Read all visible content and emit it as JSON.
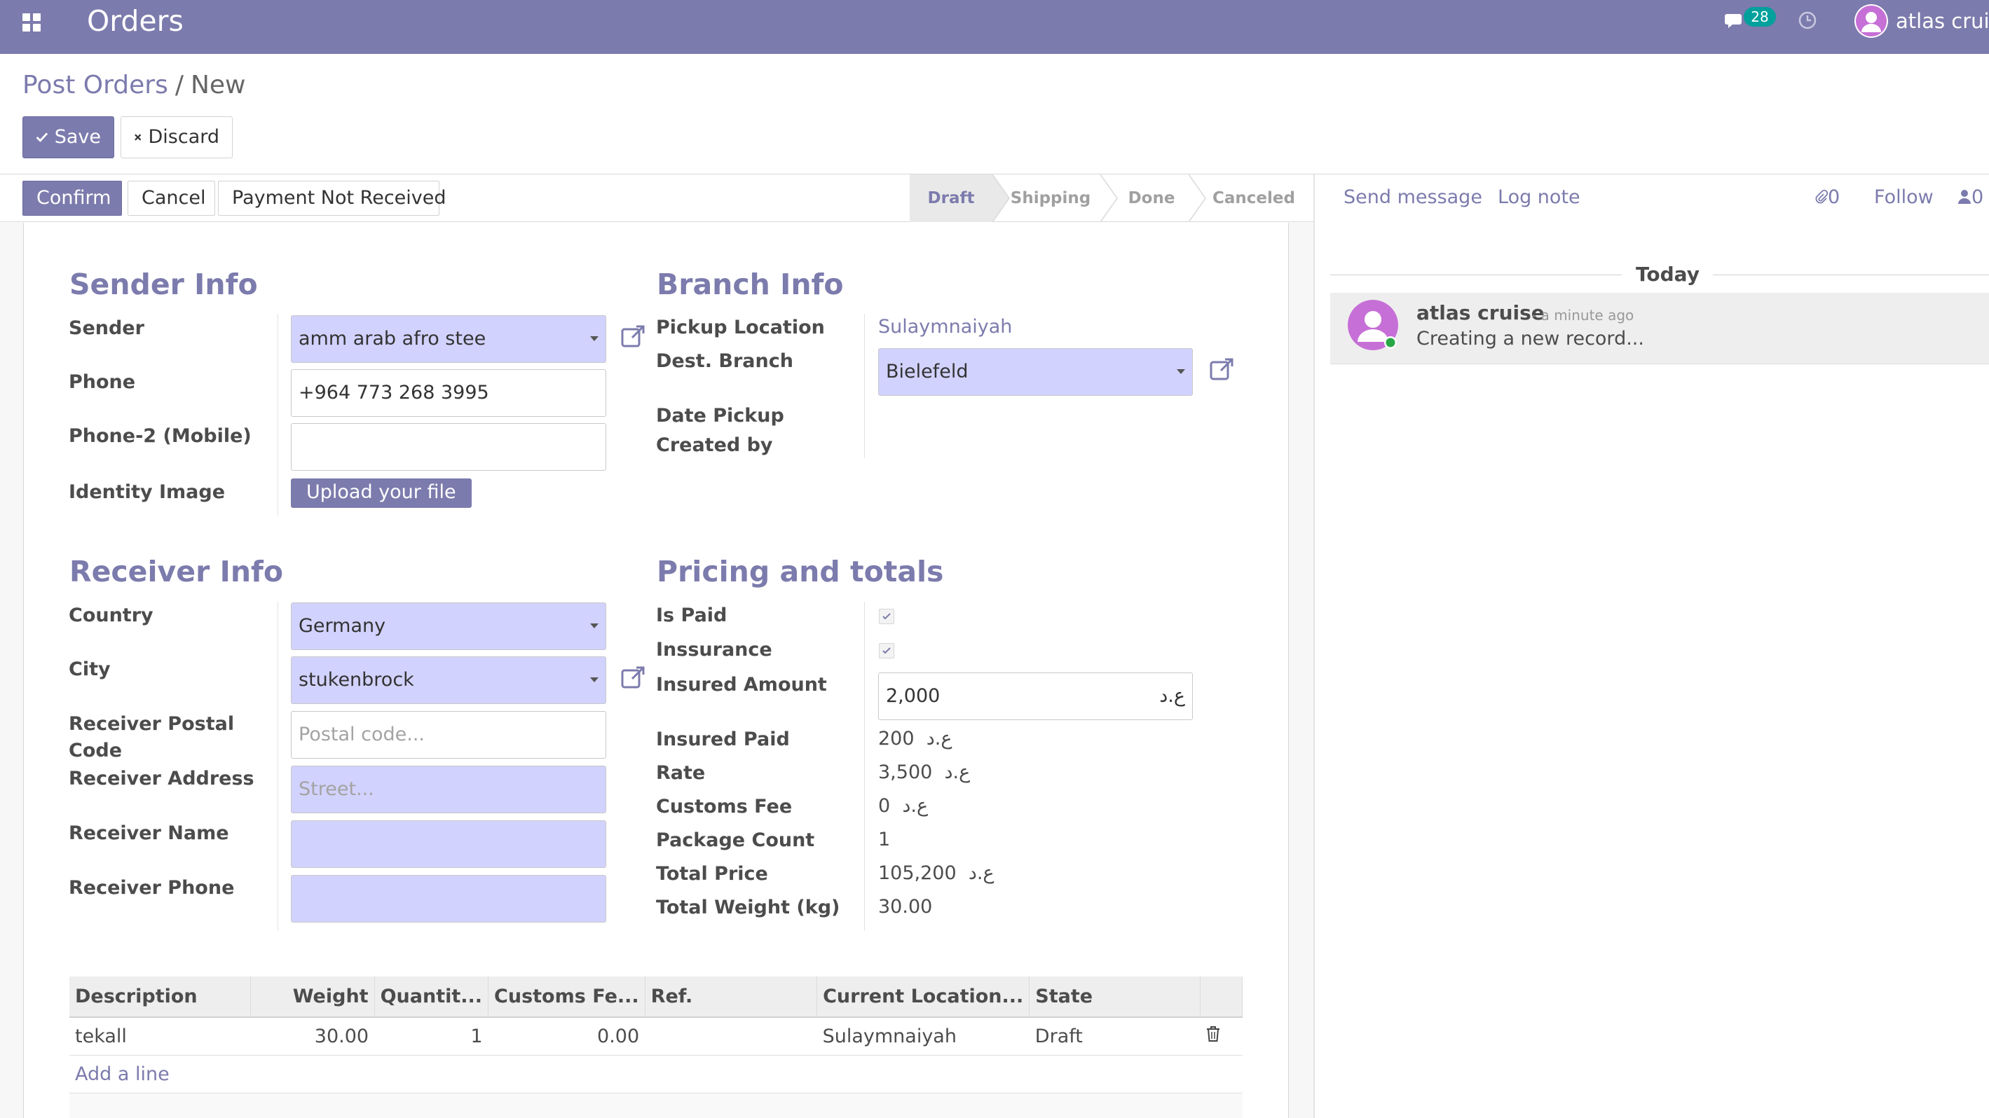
{
  "navbar": {
    "app_title": "Orders",
    "chat_count": "28",
    "user_name": "atlas cruise"
  },
  "breadcrumb": {
    "parent": "Post Orders",
    "separator": "/",
    "current": "New"
  },
  "buttons": {
    "save": "Save",
    "discard": "Discard"
  },
  "statusbar": {
    "confirm": "Confirm",
    "cancel": "Cancel",
    "payment_not_received": "Payment Not Received",
    "stages": [
      "Draft",
      "Shipping",
      "Done",
      "Canceled"
    ],
    "active_stage": "Draft"
  },
  "sender": {
    "title": "Sender Info",
    "sender_label": "Sender",
    "sender_value": "amm arab afro stee",
    "phone_label": "Phone",
    "phone_value": "+964 773 268 3995",
    "phone2_label": "Phone-2 (Mobile)",
    "phone2_value": "",
    "identity_label": "Identity Image",
    "upload_label": "Upload your file"
  },
  "branch": {
    "title": "Branch Info",
    "pickup_label": "Pickup Location",
    "pickup_value": "Sulaymnaiyah",
    "dest_label": "Dest. Branch",
    "dest_value": "Bielefeld",
    "date_label": "Date Pickup",
    "created_label": "Created by"
  },
  "receiver": {
    "title": "Receiver Info",
    "country_label": "Country",
    "country_value": "Germany",
    "city_label": "City",
    "city_value": "stukenbrock",
    "postal_label_1": "Receiver Postal",
    "postal_label_2": "Code",
    "postal_placeholder": "Postal code...",
    "address_label": "Receiver Address",
    "address_placeholder": "Street...",
    "name_label": "Receiver Name",
    "phone_label": "Receiver Phone"
  },
  "pricing": {
    "title": "Pricing and totals",
    "is_paid_label": "Is Paid",
    "is_paid": true,
    "insurance_label": "Inssurance",
    "insurance": true,
    "insured_amount_label": "Insured Amount",
    "insured_amount_value": "2,000",
    "currency": "ع.د",
    "insured_paid_label": "Insured Paid",
    "insured_paid_value": "200",
    "rate_label": "Rate",
    "rate_value": "3,500",
    "customs_fee_label": "Customs Fee",
    "customs_fee_value": "0",
    "package_count_label": "Package Count",
    "package_count_value": "1",
    "total_price_label": "Total Price",
    "total_price_value": "105,200",
    "total_weight_label": "Total Weight (kg)",
    "total_weight_value": "30.00"
  },
  "lines": {
    "headers": [
      "Description",
      "Weight",
      "Quantit...",
      "Customs Fe...",
      "Ref.",
      "Current Location...",
      "State"
    ],
    "rows": [
      {
        "description": "tekall",
        "weight": "30.00",
        "quantity": "1",
        "customs": "0.00",
        "ref": "",
        "location": "Sulaymnaiyah",
        "state": "Draft"
      }
    ],
    "add_line": "Add a line"
  },
  "chatter": {
    "send_message": "Send message",
    "log_note": "Log note",
    "attachments_count": "0",
    "follow": "Follow",
    "followers_count": "0",
    "today": "Today",
    "messages": [
      {
        "author": "atlas cruise",
        "time": "- a minute ago",
        "body": "Creating a new record..."
      }
    ]
  },
  "colors": {
    "brand": "#7c7bad",
    "required_field": "#d2d2ff",
    "ribbon": "#2ea84f",
    "chat_badge": "#00a09d"
  }
}
